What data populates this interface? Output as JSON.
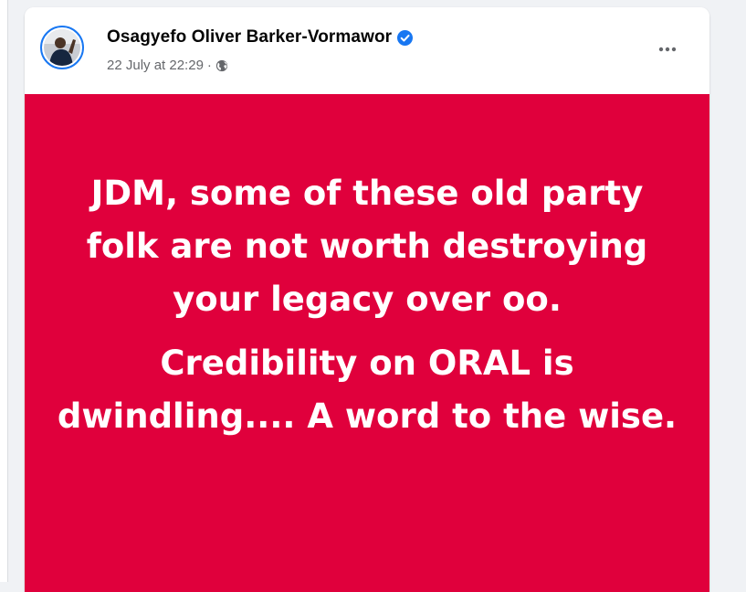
{
  "post": {
    "author": {
      "name": "Osagyefo Oliver Barker-Vormawor",
      "verified": true,
      "avatar": "avatar-photo"
    },
    "timestamp": "22 July at 22:29",
    "separator": "·",
    "audience_icon": "globe-icon",
    "menu_icon": "more-icon",
    "background_color": "#e0003c",
    "text_color": "#ffffff",
    "paragraphs": [
      "JDM, some of these old party folk are not worth destroying your legacy over oo.",
      "Credibility on ORAL is dwindling.... A word to the wise."
    ]
  },
  "colors": {
    "verified_badge": "#1877f2",
    "page_background": "#f0f2f5",
    "secondary_text": "#65676b"
  }
}
